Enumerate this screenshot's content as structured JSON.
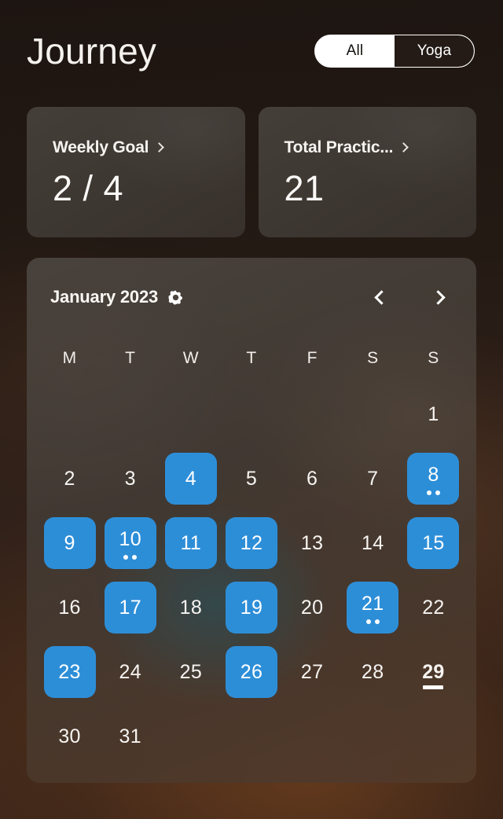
{
  "header": {
    "title": "Journey",
    "segmented": {
      "options": [
        {
          "label": "All",
          "selected": true
        },
        {
          "label": "Yoga",
          "selected": false
        }
      ]
    }
  },
  "stats": [
    {
      "label": "Weekly Goal",
      "value": "2 / 4",
      "chevron": "chevron-right-icon"
    },
    {
      "label": "Total Practic...",
      "value": "21",
      "chevron": "chevron-right-icon"
    }
  ],
  "calendar": {
    "month_label": "January 2023",
    "settings_icon": "gear-icon",
    "prev_label": "‹",
    "next_label": "›",
    "weekdays": [
      "M",
      "T",
      "W",
      "T",
      "F",
      "S",
      "S"
    ],
    "weeks": [
      [
        {
          "day": "",
          "empty": true
        },
        {
          "day": "",
          "empty": true
        },
        {
          "day": "",
          "empty": true
        },
        {
          "day": "",
          "empty": true
        },
        {
          "day": "",
          "empty": true
        },
        {
          "day": "",
          "empty": true
        },
        {
          "day": "1",
          "active": false,
          "dots": 0
        }
      ],
      [
        {
          "day": "2",
          "active": false,
          "dots": 0
        },
        {
          "day": "3",
          "active": false,
          "dots": 0
        },
        {
          "day": "4",
          "active": true,
          "dots": 0
        },
        {
          "day": "5",
          "active": false,
          "dots": 0
        },
        {
          "day": "6",
          "active": false,
          "dots": 0
        },
        {
          "day": "7",
          "active": false,
          "dots": 0
        },
        {
          "day": "8",
          "active": true,
          "dots": 2
        }
      ],
      [
        {
          "day": "9",
          "active": true,
          "dots": 0
        },
        {
          "day": "10",
          "active": true,
          "dots": 2
        },
        {
          "day": "11",
          "active": true,
          "dots": 0
        },
        {
          "day": "12",
          "active": true,
          "dots": 0
        },
        {
          "day": "13",
          "active": false,
          "dots": 0
        },
        {
          "day": "14",
          "active": false,
          "dots": 0
        },
        {
          "day": "15",
          "active": true,
          "dots": 0
        }
      ],
      [
        {
          "day": "16",
          "active": false,
          "dots": 0
        },
        {
          "day": "17",
          "active": true,
          "dots": 0
        },
        {
          "day": "18",
          "active": false,
          "dots": 0
        },
        {
          "day": "19",
          "active": true,
          "dots": 0
        },
        {
          "day": "20",
          "active": false,
          "dots": 0
        },
        {
          "day": "21",
          "active": true,
          "dots": 2
        },
        {
          "day": "22",
          "active": false,
          "dots": 0
        }
      ],
      [
        {
          "day": "23",
          "active": true,
          "dots": 0
        },
        {
          "day": "24",
          "active": false,
          "dots": 0
        },
        {
          "day": "25",
          "active": false,
          "dots": 0
        },
        {
          "day": "26",
          "active": true,
          "dots": 0
        },
        {
          "day": "27",
          "active": false,
          "dots": 0
        },
        {
          "day": "28",
          "active": false,
          "dots": 0
        },
        {
          "day": "29",
          "active": false,
          "dots": 0,
          "today": true
        }
      ],
      [
        {
          "day": "30",
          "active": false,
          "dots": 0
        },
        {
          "day": "31",
          "active": false,
          "dots": 0
        },
        {
          "day": "",
          "empty": true
        },
        {
          "day": "",
          "empty": true
        },
        {
          "day": "",
          "empty": true
        },
        {
          "day": "",
          "empty": true
        },
        {
          "day": "",
          "empty": true
        }
      ]
    ]
  },
  "colors": {
    "accent_blue": "#2d8ed8",
    "card_surface": "#3e3935",
    "page_background": "#241a14",
    "text_primary": "#f7f4f1",
    "segmented_on": "#ffffff"
  }
}
